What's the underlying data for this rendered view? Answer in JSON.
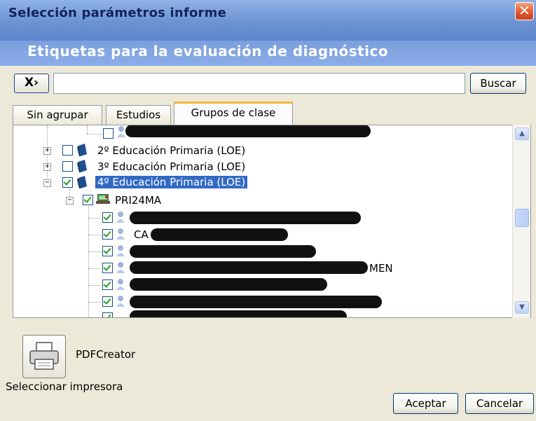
{
  "window": {
    "title": "Selección parámetros informe",
    "close_glyph": "✕"
  },
  "header": {
    "subtitle": "Etiquetas para la evaluación de diagnóstico"
  },
  "search": {
    "clear_label": "X›",
    "value": "",
    "button_label": "Buscar"
  },
  "tabs": [
    {
      "label": "Sin agrupar",
      "active": false
    },
    {
      "label": "Estudios",
      "active": false
    },
    {
      "label": "Grupos de clase",
      "active": true
    }
  ],
  "tree": {
    "items": [
      {
        "label": "",
        "checked": false,
        "icon": "person-icon",
        "redacted": true
      },
      {
        "label": "2º Educación Primaria (LOE)",
        "checked": false,
        "icon": "book-icon",
        "expander": "+"
      },
      {
        "label": "3º Educación Primaria (LOE)",
        "checked": false,
        "icon": "book-icon",
        "expander": "+"
      },
      {
        "label": "4º Educación Primaria (LOE)",
        "checked": true,
        "icon": "book-icon",
        "expander": "−",
        "selected": true
      },
      {
        "label": "PRI24MA",
        "checked": true,
        "icon": "group-icon",
        "expander": "−"
      },
      {
        "label": "",
        "checked": true,
        "icon": "person-icon",
        "redacted": true
      },
      {
        "label": "CA",
        "checked": true,
        "icon": "person-icon",
        "redacted": true
      },
      {
        "label": "",
        "checked": true,
        "icon": "person-icon",
        "redacted": true
      },
      {
        "label": "MEN",
        "checked": true,
        "icon": "person-icon",
        "redacted": true
      },
      {
        "label": "",
        "checked": true,
        "icon": "person-icon",
        "redacted": true
      },
      {
        "label": "",
        "checked": true,
        "icon": "person-icon",
        "redacted": true
      }
    ]
  },
  "printer": {
    "name": "PDFCreator",
    "select_label": "Seleccionar impresora",
    "icon": "printer-icon"
  },
  "footer": {
    "accept_label": "Aceptar",
    "cancel_label": "Cancelar"
  },
  "colors": {
    "title_bar": "#6d93d3",
    "selection": "#316ac5",
    "check": "#21a121",
    "tab_highlight": "#f7b642"
  }
}
